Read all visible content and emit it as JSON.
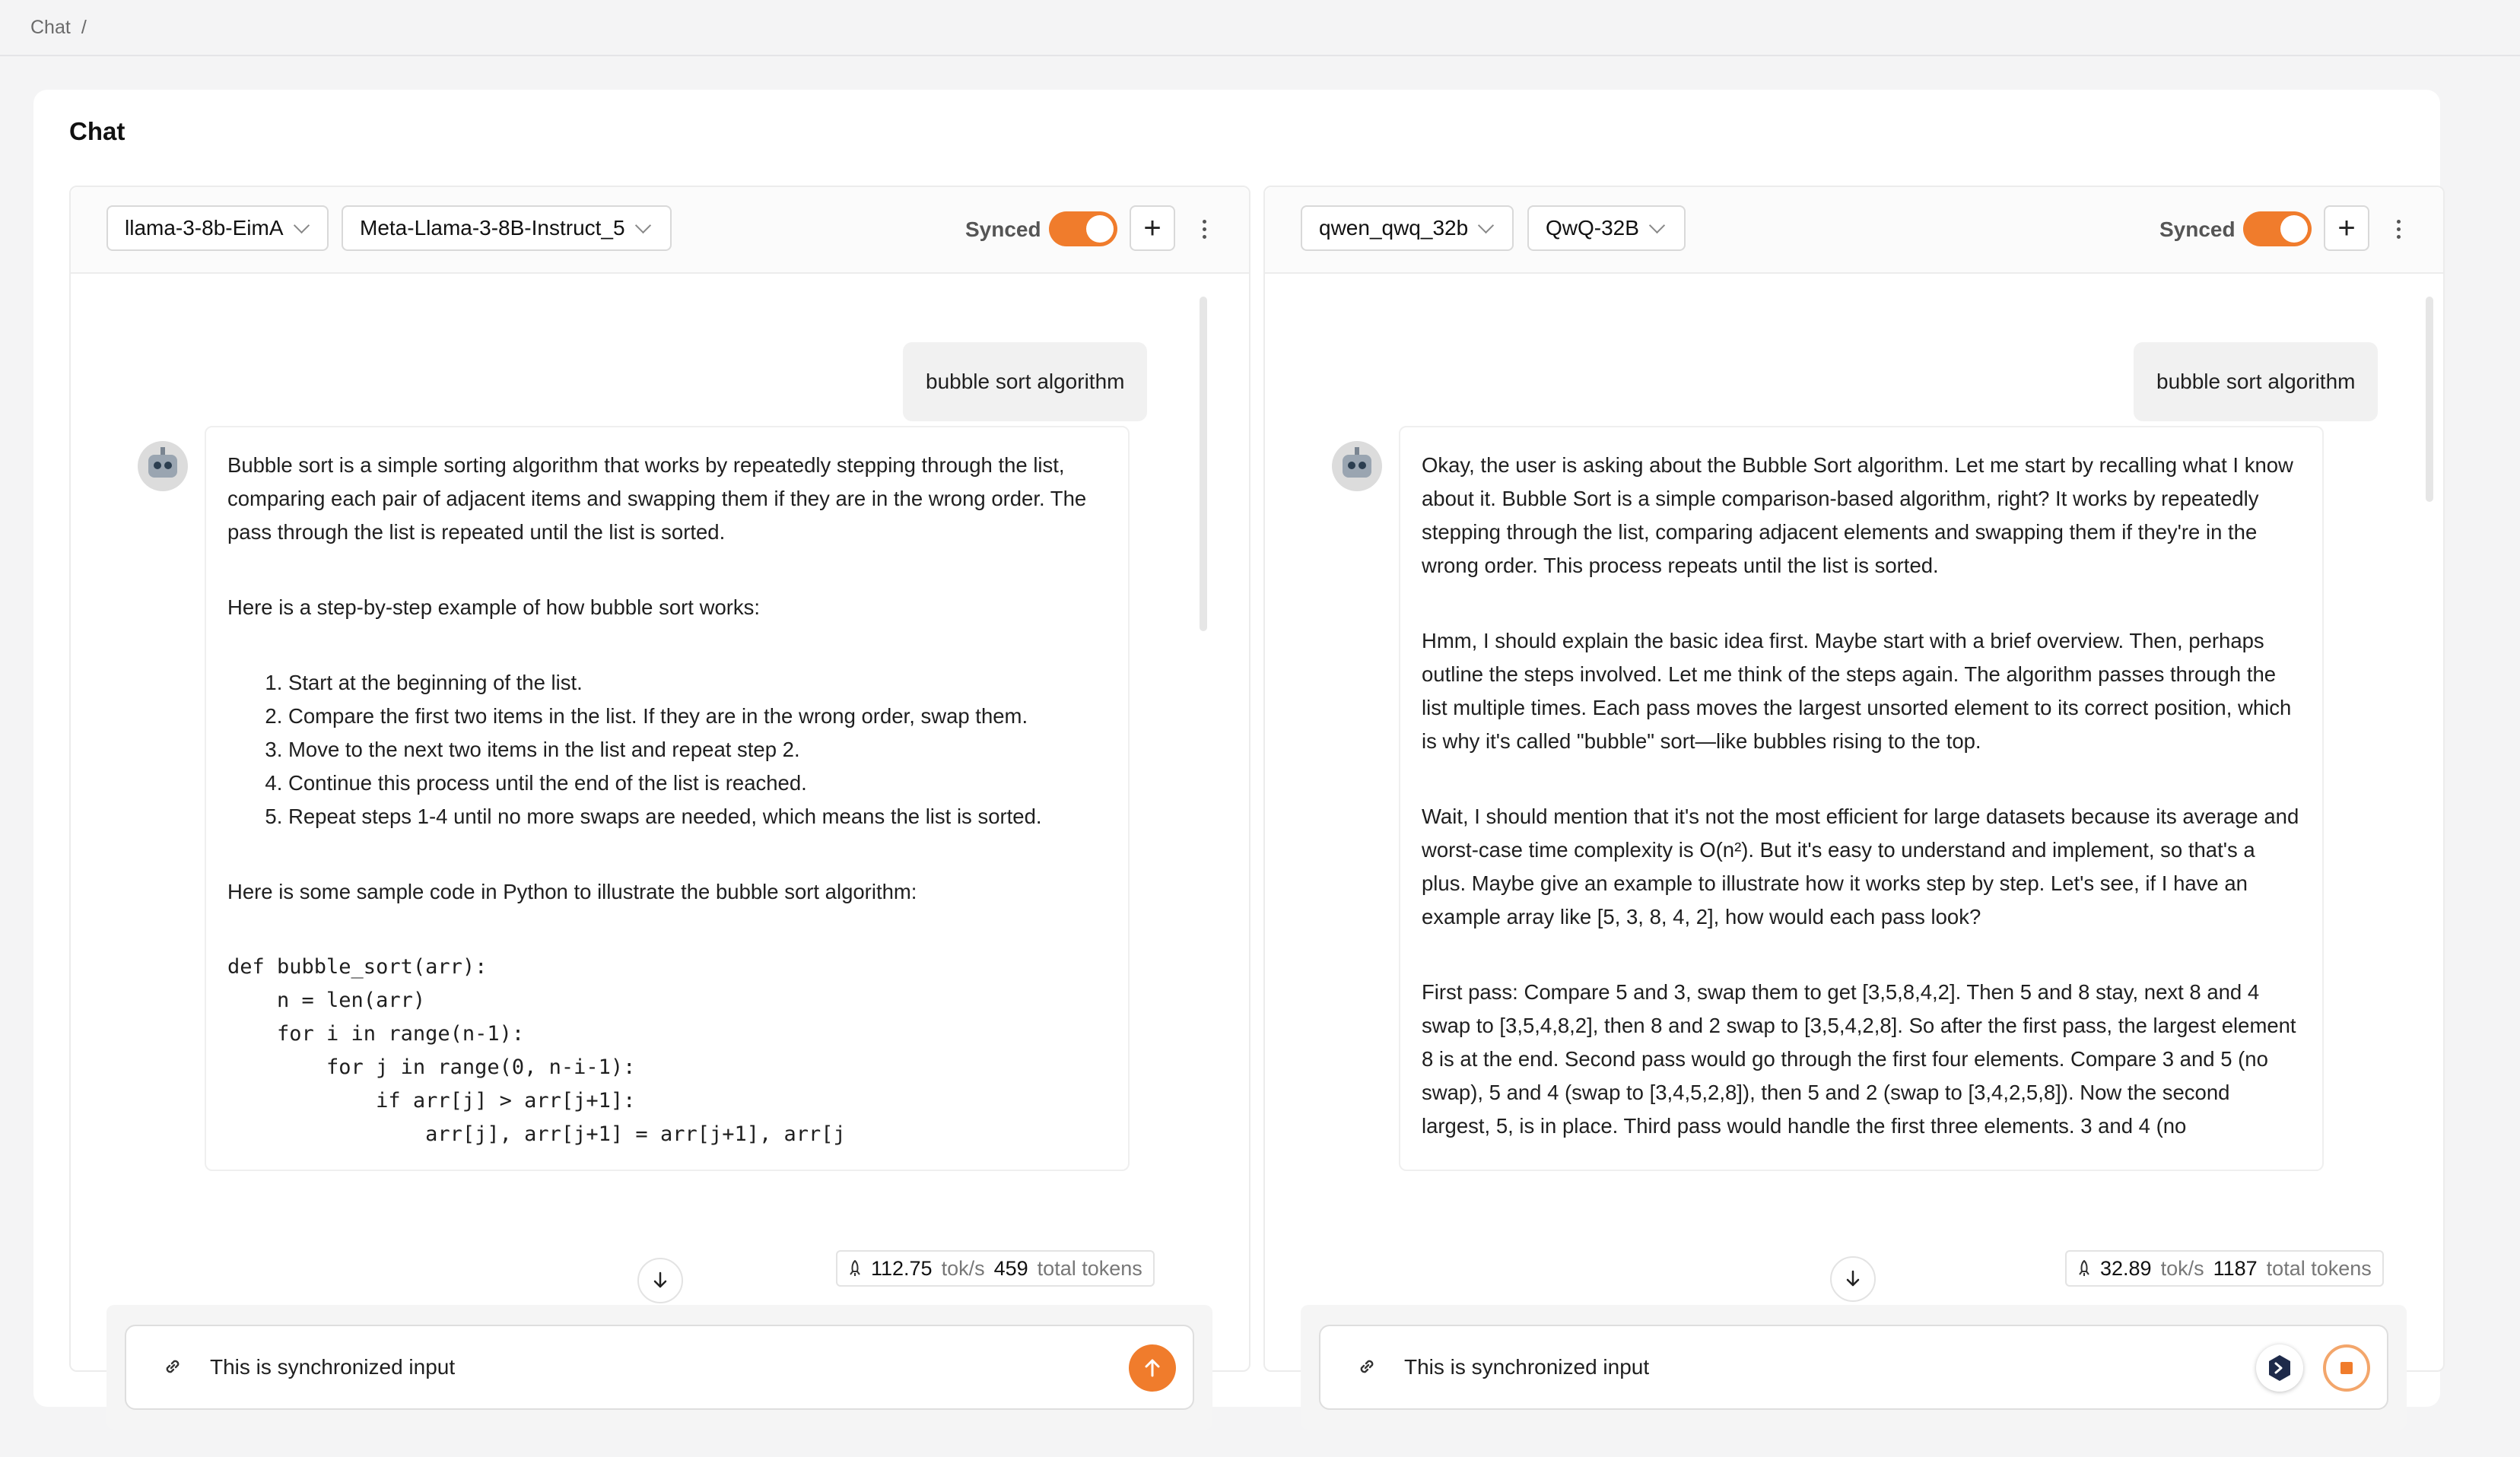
{
  "breadcrumb": {
    "item": "Chat",
    "separator": "/"
  },
  "card": {
    "title": "Chat"
  },
  "panels": [
    {
      "provider": "llama-3-8b-EimA",
      "model": "Meta-Llama-3-8B-Instruct_5",
      "synced_label": "Synced",
      "synced": true,
      "user_message": "bubble sort algorithm",
      "assistant": {
        "p1": "Bubble sort is a simple sorting algorithm that works by repeatedly stepping through the list, comparing each pair of adjacent items and swapping them if they are in the wrong order. The pass through the list is repeated until the list is sorted.",
        "p2": "Here is a step-by-step example of how bubble sort works:",
        "steps": [
          "Start at the beginning of the list.",
          "Compare the first two items in the list. If they are in the wrong order, swap them.",
          "Move to the next two items in the list and repeat step 2.",
          "Continue this process until the end of the list is reached.",
          "Repeat steps 1-4 until no more swaps are needed, which means the list is sorted."
        ],
        "p3": "Here is some sample code in Python to illustrate the bubble sort algorithm:",
        "code": "def bubble_sort(arr):\n    n = len(arr)\n    for i in range(n-1):\n        for j in range(0, n-i-1):\n            if arr[j] > arr[j+1]:\n                arr[j], arr[j+1] = arr[j+1], arr[j"
      },
      "stats": {
        "speed": "112.75",
        "speed_unit": "tok/s",
        "tokens": "459",
        "tokens_unit": "total tokens"
      },
      "input_text": "This is synchronized input"
    },
    {
      "provider": "qwen_qwq_32b",
      "model": "QwQ-32B",
      "synced_label": "Synced",
      "synced": true,
      "user_message": "bubble sort algorithm",
      "assistant": {
        "p1": "Okay, the user is asking about the Bubble Sort algorithm. Let me start by recalling what I know about it. Bubble Sort is a simple comparison-based algorithm, right? It works by repeatedly stepping through the list, comparing adjacent elements and swapping them if they're in the wrong order. This process repeats until the list is sorted.",
        "p2": "Hmm, I should explain the basic idea first. Maybe start with a brief overview. Then, perhaps outline the steps involved. Let me think of the steps again. The algorithm passes through the list multiple times. Each pass moves the largest unsorted element to its correct position, which is why it's called \"bubble\" sort—like bubbles rising to the top.",
        "p3": "Wait, I should mention that it's not the most efficient for large datasets because its average and worst-case time complexity is O(n²). But it's easy to understand and implement, so that's a plus. Maybe give an example to illustrate how it works step by step. Let's see, if I have an example array like [5, 3, 8, 4, 2], how would each pass look?",
        "p4": "First pass: Compare 5 and 3, swap them to get [3,5,8,4,2]. Then 5 and 8 stay, next 8 and 4 swap to [3,5,4,8,2], then 8 and 2 swap to [3,5,4,2,8]. So after the first pass, the largest element 8 is at the end. Second pass would go through the first four elements. Compare 3 and 5 (no swap), 5 and 4 (swap to [3,4,5,2,8]), then 5 and 2 (swap to [3,4,2,5,8]). Now the second largest, 5, is in place. Third pass would handle the first three elements. 3 and 4 (no"
      },
      "stats": {
        "speed": "32.89",
        "speed_unit": "tok/s",
        "tokens": "1187",
        "tokens_unit": "total tokens"
      },
      "input_text": "This is synchronized input"
    }
  ],
  "colors": {
    "accent": "#f07c2c",
    "background": "#f4f4f5"
  },
  "icons": [
    "chevron-down-icon",
    "plus-icon",
    "more-vertical-icon",
    "robot-avatar-icon",
    "arrow-down-icon",
    "rocket-icon",
    "link-icon",
    "arrow-up-icon",
    "stop-icon",
    "extension-icon"
  ]
}
